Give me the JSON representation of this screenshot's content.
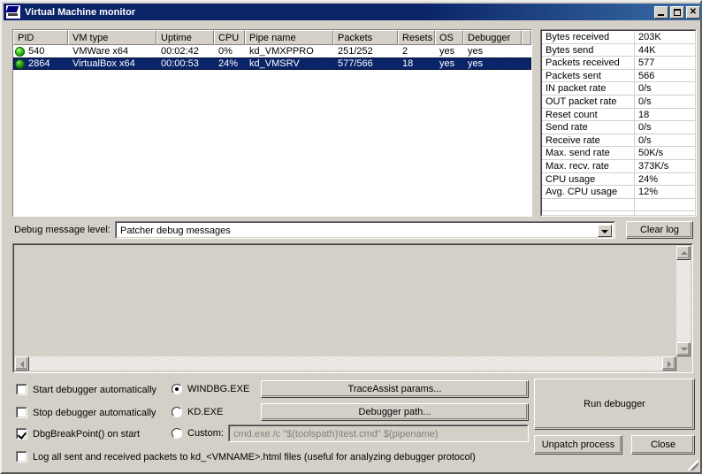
{
  "window": {
    "title": "Virtual Machine monitor",
    "icon": "vm-monitor-icon",
    "minimize_label": "_",
    "maximize_label": "□",
    "close_label": "✕"
  },
  "vm_list": {
    "columns": [
      "PID",
      "VM type",
      "Uptime",
      "CPU",
      "Pipe name",
      "Packets",
      "Resets",
      "OS",
      "Debugger"
    ],
    "rows": [
      {
        "status": "running",
        "pid": "540",
        "vm_type": "VMWare x64",
        "uptime": "00:02:42",
        "cpu": "0%",
        "pipe_name": "kd_VMXPPRO",
        "packets": "251/252",
        "resets": "2",
        "os": "yes",
        "debugger": "yes",
        "selected": false
      },
      {
        "status": "running",
        "pid": "2864",
        "vm_type": "VirtualBox x64",
        "uptime": "00:00:53",
        "cpu": "24%",
        "pipe_name": "kd_VMSRV",
        "packets": "577/566",
        "resets": "18",
        "os": "yes",
        "debugger": "yes",
        "selected": true
      }
    ]
  },
  "stats": {
    "rows": [
      {
        "name": "Bytes received",
        "value": "203K"
      },
      {
        "name": "Bytes send",
        "value": "44K"
      },
      {
        "name": "Packets received",
        "value": "577"
      },
      {
        "name": "Packets sent",
        "value": "566"
      },
      {
        "name": "IN packet rate",
        "value": "0/s"
      },
      {
        "name": "OUT packet rate",
        "value": "0/s"
      },
      {
        "name": "Reset count",
        "value": "18"
      },
      {
        "name": "Send rate",
        "value": "0/s"
      },
      {
        "name": "Receive rate",
        "value": "0/s"
      },
      {
        "name": "Max. send rate",
        "value": "50K/s"
      },
      {
        "name": "Max. recv. rate",
        "value": "373K/s"
      },
      {
        "name": "CPU usage",
        "value": "24%"
      },
      {
        "name": "Avg. CPU usage",
        "value": "12%"
      },
      {
        "name": "",
        "value": ""
      },
      {
        "name": "",
        "value": ""
      }
    ]
  },
  "debug_level": {
    "label": "Debug message level:",
    "selected": "Patcher debug messages",
    "options": [
      "Patcher debug messages"
    ]
  },
  "clear_log": {
    "label": "Clear log"
  },
  "log": {
    "text": ""
  },
  "options": {
    "checkboxes": [
      {
        "label": "Start debugger automatically",
        "checked": false
      },
      {
        "label": "Stop debugger automatically",
        "checked": false
      },
      {
        "label": "DbgBreakPoint() on start",
        "checked": true
      },
      {
        "label": "Log all sent and received packets to kd_<VMNAME>.html files (useful for analyzing debugger protocol)",
        "checked": false
      }
    ],
    "radios": [
      {
        "label": "WINDBG.EXE",
        "selected": true
      },
      {
        "label": "KD.EXE",
        "selected": false
      },
      {
        "label": "Custom:",
        "selected": false
      }
    ],
    "custom_command": "cmd.exe /c \"$(toolspath)\\test.cmd\" $(pipename)"
  },
  "buttons": {
    "trace_assist": "TraceAssist params...",
    "debugger_path": "Debugger path...",
    "run_debugger": "Run debugger",
    "unpatch_process": "Unpatch process",
    "close": "Close"
  },
  "colors": {
    "title_bar": "#0a246a",
    "face": "#d4d0c8",
    "selection": "#0a246a",
    "status_green": "#35c516"
  }
}
